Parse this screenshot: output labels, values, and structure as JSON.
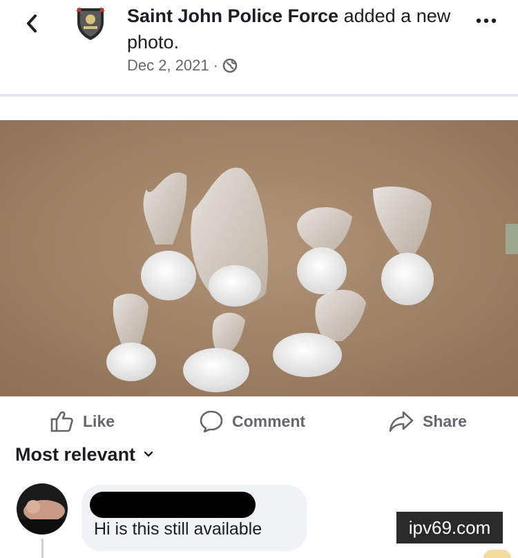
{
  "header": {
    "page_name": "Saint John Police Force",
    "action_text": "added a new photo.",
    "date": "Dec 2, 2021",
    "separator": "·",
    "icons": {
      "back": "chevron-left-icon",
      "audience": "globe-icon",
      "more": "more-dots-icon",
      "page_avatar": "police-crest-icon"
    }
  },
  "actions": {
    "like_label": "Like",
    "comment_label": "Comment",
    "share_label": "Share"
  },
  "comments": {
    "sort_label": "Most relevant",
    "items": [
      {
        "text": "Hi is this still available"
      }
    ]
  },
  "watermark": {
    "text": "ipv69.com"
  },
  "colors": {
    "text": "#1c1e21",
    "muted": "#65676b",
    "bubble": "#f0f2f5",
    "photo_background": "#a88a6c"
  }
}
